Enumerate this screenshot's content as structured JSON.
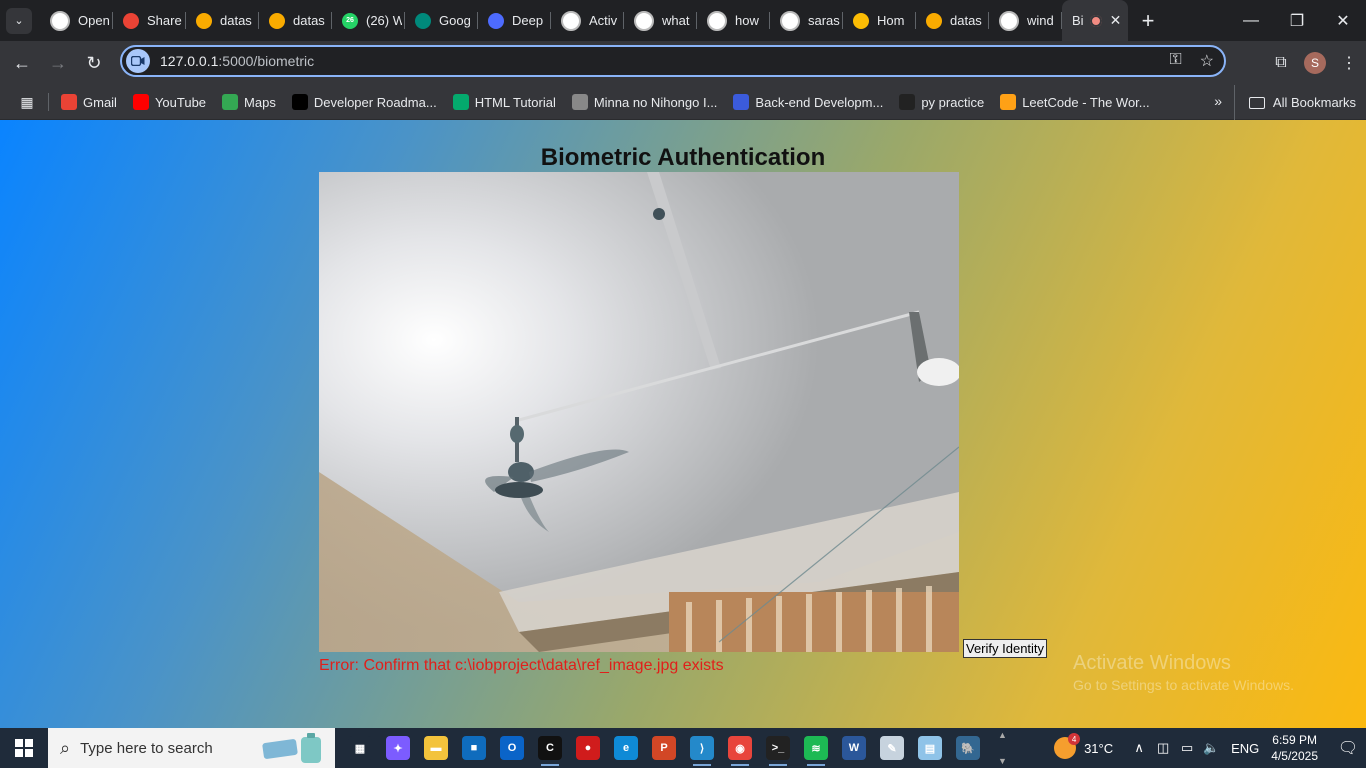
{
  "browser": {
    "tabs": [
      {
        "label": "Open",
        "icon": "openai-icon",
        "color": "#ffffff"
      },
      {
        "label": "Share",
        "icon": "gmail-icon",
        "color": "#ea4335"
      },
      {
        "label": "datas",
        "icon": "infinity-icon",
        "color": "#f9ab00"
      },
      {
        "label": "datas",
        "icon": "infinity-icon",
        "color": "#f9ab00"
      },
      {
        "label": "(26) W",
        "icon": "whatsapp-icon",
        "color": "#25d366"
      },
      {
        "label": "Goog",
        "icon": "meet-icon",
        "color": "#00897b"
      },
      {
        "label": "Deep",
        "icon": "deepseek-icon",
        "color": "#4d6bfe"
      },
      {
        "label": "Activ",
        "icon": "openai-icon",
        "color": "#ffffff"
      },
      {
        "label": "what",
        "icon": "google-icon",
        "color": "#ffffff"
      },
      {
        "label": "how",
        "icon": "google-icon",
        "color": "#ffffff"
      },
      {
        "label": "saras",
        "icon": "github-icon",
        "color": "#ffffff"
      },
      {
        "label": "Hom",
        "icon": "drive-icon",
        "color": "#fbbc04"
      },
      {
        "label": "datas",
        "icon": "infinity-icon",
        "color": "#f9ab00"
      },
      {
        "label": "wind",
        "icon": "google-icon",
        "color": "#ffffff"
      }
    ],
    "active_tab": {
      "label": "Bi"
    },
    "url_host": "127.0.0.1",
    "url_path": ":5000/biometric",
    "avatar_letter": "S",
    "whatsapp_badge": "26",
    "bookmarks": [
      {
        "label": "Gmail",
        "icon": "gmail-icon",
        "color": "#ea4335"
      },
      {
        "label": "YouTube",
        "icon": "youtube-icon",
        "color": "#ff0000"
      },
      {
        "label": "Maps",
        "icon": "maps-icon",
        "color": "#34a853"
      },
      {
        "label": "Developer Roadma...",
        "icon": "roadmap-icon",
        "color": "#000000"
      },
      {
        "label": "HTML Tutorial",
        "icon": "w3schools-icon",
        "color": "#04aa6d"
      },
      {
        "label": "Minna no Nihongo I...",
        "icon": "book-icon",
        "color": "#888888"
      },
      {
        "label": "Back-end Developm...",
        "icon": "course-icon",
        "color": "#3b5bdb"
      },
      {
        "label": "py practice",
        "icon": "cc-icon",
        "color": "#222222"
      },
      {
        "label": "LeetCode - The Wor...",
        "icon": "leetcode-icon",
        "color": "#ffa116"
      }
    ],
    "all_bookmarks": "All Bookmarks"
  },
  "page": {
    "title": "Biometric Authentication",
    "verify_button": "Verify Identity",
    "error": "Error: Confirm that c:\\iobproject\\data\\ref_image.jpg exists",
    "watermark_line1": "Activate Windows",
    "watermark_line2": "Go to Settings to activate Windows."
  },
  "taskbar": {
    "search_placeholder": "Type here to search",
    "temperature": "31°C",
    "weather_badge": "4",
    "language": "ENG",
    "time": "6:59 PM",
    "date": "4/5/2025",
    "apps": [
      {
        "name": "task-view-icon",
        "color": "#1f2b3a",
        "glyph": "▦"
      },
      {
        "name": "copilot-icon",
        "color": "#7c5cff",
        "glyph": "✦"
      },
      {
        "name": "file-explorer-icon",
        "color": "#f3c33c",
        "glyph": "▬"
      },
      {
        "name": "store-icon",
        "color": "#0f6cbd",
        "glyph": "■"
      },
      {
        "name": "outlook-icon",
        "color": "#0a64c8",
        "glyph": "O"
      },
      {
        "name": "clion-icon",
        "color": "#111111",
        "glyph": "C"
      },
      {
        "name": "recorder-icon",
        "color": "#d01c1c",
        "glyph": "●"
      },
      {
        "name": "edge-icon",
        "color": "#0f8ad6",
        "glyph": "e"
      },
      {
        "name": "powerpoint-icon",
        "color": "#d24726",
        "glyph": "P"
      },
      {
        "name": "vscode-icon",
        "color": "#2489ca",
        "glyph": "⟩"
      },
      {
        "name": "chrome-icon",
        "color": "#e8453c",
        "glyph": "◉"
      },
      {
        "name": "terminal-icon",
        "color": "#222222",
        "glyph": ">_"
      },
      {
        "name": "spotify-icon",
        "color": "#1db954",
        "glyph": "≋"
      },
      {
        "name": "word-icon",
        "color": "#2b579a",
        "glyph": "W"
      },
      {
        "name": "paint-icon",
        "color": "#c7d3de",
        "glyph": "✎"
      },
      {
        "name": "notepad-icon",
        "color": "#8fc3e8",
        "glyph": "▤"
      },
      {
        "name": "pgadmin-icon",
        "color": "#336791",
        "glyph": "🐘"
      }
    ]
  }
}
